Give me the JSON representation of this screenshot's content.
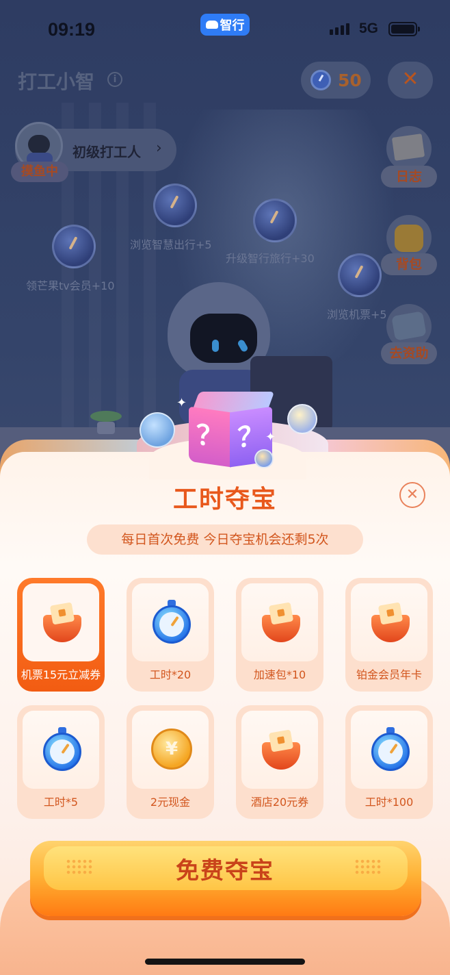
{
  "status_bar": {
    "time": "09:19",
    "app_badge": "智行",
    "network": "5G"
  },
  "header": {
    "title": "打工小智",
    "info_icon": "info-icon",
    "hours_count": "50",
    "close_icon": "close-icon"
  },
  "profile": {
    "level": "初级打工人",
    "chevron": "›",
    "status": "摸鱼中"
  },
  "side_menu": [
    {
      "label": "日志",
      "icon": "notebook-icon"
    },
    {
      "label": "背包",
      "icon": "backpack-icon"
    },
    {
      "label": "去资助",
      "icon": "ticket-icon"
    }
  ],
  "tasks": [
    {
      "label": "领芒果tv会员+10"
    },
    {
      "label": "浏览智慧出行+5"
    },
    {
      "label": "升级智行旅行+30"
    },
    {
      "label": "浏览机票+5"
    }
  ],
  "sheet": {
    "title": "工时夺宝",
    "notice": "每日首次免费 今日夺宝机会还剩5次",
    "mystery_box": "？",
    "close_icon": "close-circle-icon"
  },
  "prizes": [
    {
      "name": "机票15元立减券",
      "icon": "coupon-pouch-icon",
      "selected": true
    },
    {
      "name": "工时*20",
      "icon": "stopwatch-icon",
      "selected": false
    },
    {
      "name": "加速包*10",
      "icon": "boost-pouch-icon",
      "selected": false
    },
    {
      "name": "铂金会员年卡",
      "icon": "vip-pouch-icon",
      "selected": false
    },
    {
      "name": "工时*5",
      "icon": "stopwatch-icon",
      "selected": false
    },
    {
      "name": "2元现金",
      "icon": "coin-icon",
      "selected": false
    },
    {
      "name": "酒店20元券",
      "icon": "hotel-pouch-icon",
      "selected": false
    },
    {
      "name": "工时*100",
      "icon": "stopwatch-icon",
      "selected": false
    }
  ],
  "cta": {
    "label": "免费夺宝"
  },
  "colors": {
    "accent": "#e8581c",
    "selected_card": "#f25c12",
    "cta": "#ffb337"
  }
}
